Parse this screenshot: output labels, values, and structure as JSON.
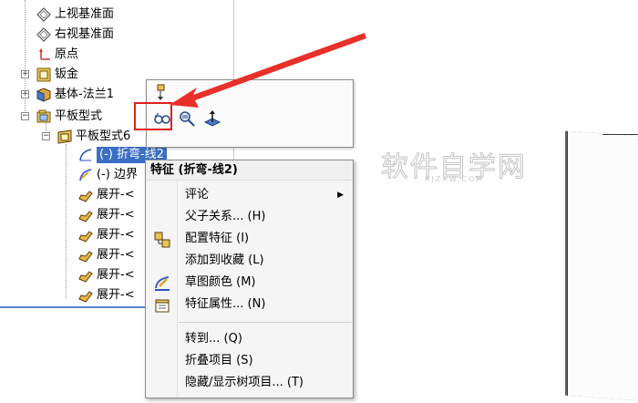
{
  "tree": {
    "items": [
      {
        "label": "上视基准面"
      },
      {
        "label": "右视基准面"
      },
      {
        "label": "原点"
      },
      {
        "label": "钣金"
      },
      {
        "label": "基体-法兰1"
      },
      {
        "label": "平板型式"
      },
      {
        "label": "平板型式6"
      },
      {
        "label": "(-) 折弯-线2"
      },
      {
        "label": "(-) 边界"
      },
      {
        "label": "展开-<"
      },
      {
        "label": "展开-<"
      },
      {
        "label": "展开-<"
      },
      {
        "label": "展开-<"
      },
      {
        "label": "展开-<"
      },
      {
        "label": "展开-<"
      }
    ]
  },
  "context_menu": {
    "title": "特征 (折弯-线2)",
    "items": [
      {
        "label": "评论",
        "has_submenu": true
      },
      {
        "label": "父子关系... (H)"
      },
      {
        "label": "配置特征 (I)"
      },
      {
        "label": "添加到收藏 (L)"
      },
      {
        "label": "草图颜色 (M)"
      },
      {
        "label": "特征属性... (N)"
      },
      {
        "label": "转到... (Q)"
      },
      {
        "label": "折叠项目 (S)"
      },
      {
        "label": "隐藏/显示树项目... (T)"
      }
    ]
  },
  "watermark": {
    "main": "软件自学网",
    "sub": "RJZXW.COM"
  },
  "colors": {
    "highlight_box": "#e0211e",
    "arrow": "#e8302a",
    "selection": "#3a6fc4"
  }
}
